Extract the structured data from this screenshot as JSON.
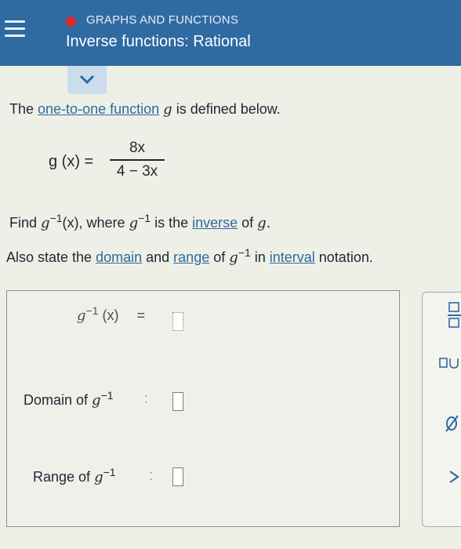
{
  "header": {
    "topic": "GRAPHS AND FUNCTIONS",
    "title": "Inverse functions: Rational"
  },
  "problem": {
    "intro_prefix": "The ",
    "intro_link": "one-to-one function",
    "intro_var": "g",
    "intro_suffix": " is defined below.",
    "lhs": "g (x) =",
    "numerator": "8x",
    "denominator": "4 − 3x",
    "find_prefix": "Find ",
    "find_g": "g",
    "find_sup": "−1",
    "find_mid": "(x), where ",
    "find_g2": "g",
    "find_sup2": "−1",
    "find_is": " is the ",
    "find_link": "inverse",
    "find_of": " of ",
    "find_g3": "g.",
    "also_prefix": "Also state the ",
    "also_domain": "domain",
    "also_and": " and ",
    "also_range": "range",
    "also_of": " of ",
    "also_g": "g",
    "also_sup": "−1",
    "also_in": " in ",
    "also_interval": "interval",
    "also_notation": " notation."
  },
  "answer": {
    "ginv_g": "g",
    "ginv_sup": "−1",
    "ginv_x": "(x)",
    "equals": "=",
    "domain_label": "Domain of ",
    "domain_g": "g",
    "domain_sup": "−1",
    "range_label": "Range of ",
    "range_g": "g",
    "range_sup": "−1",
    "colon": ":"
  },
  "colors": {
    "header_bg": "#2f6aa2",
    "accent_red": "#d72d2d",
    "link": "#2f6aa2",
    "page_bg": "#eeefe6"
  }
}
